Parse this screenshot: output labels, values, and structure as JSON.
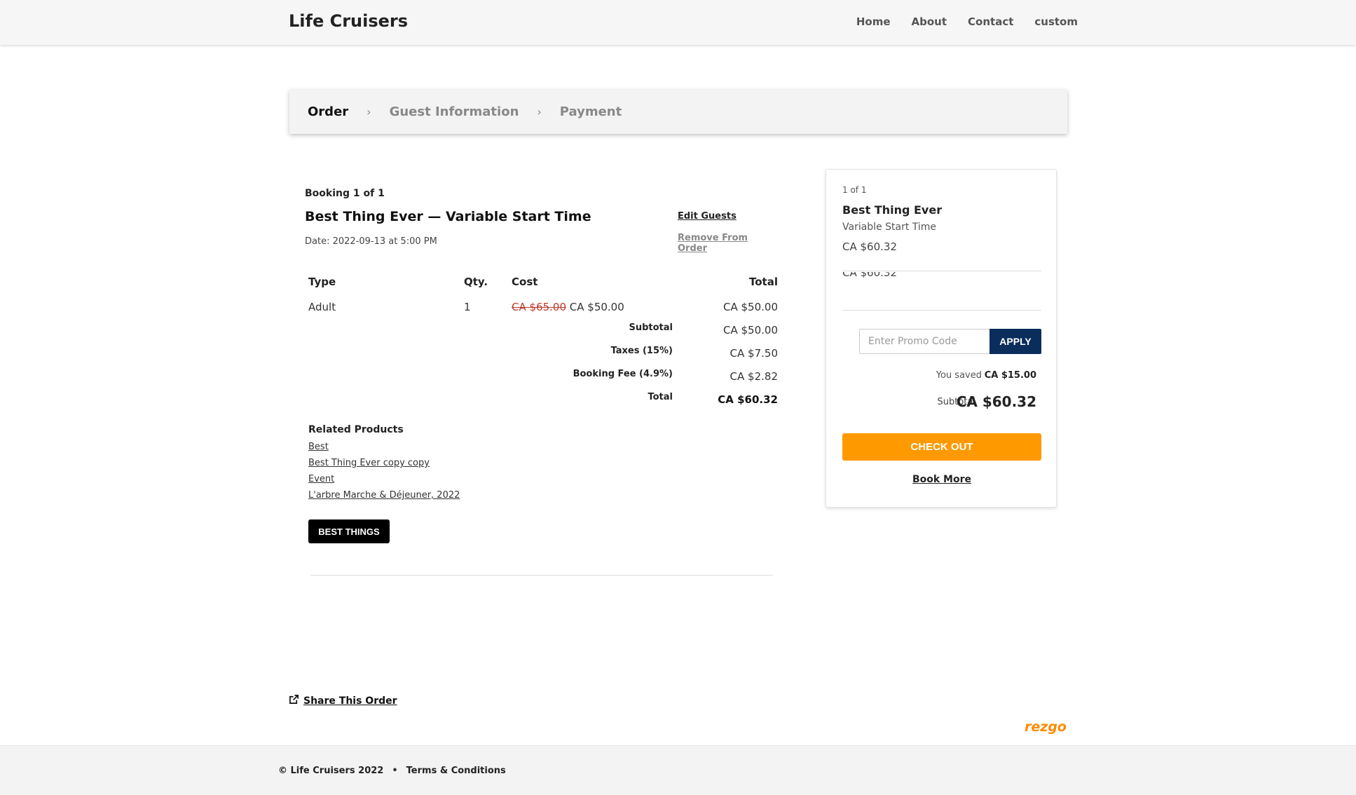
{
  "header": {
    "brand": "Life Cruisers",
    "nav": [
      "Home",
      "About",
      "Contact",
      "custom"
    ]
  },
  "steps": [
    "Order",
    "Guest Information",
    "Payment"
  ],
  "booking": {
    "count": "Booking 1 of 1",
    "title": "Best Thing Ever — Variable Start Time",
    "date": "Date: 2022-09-13 at 5:00 PM",
    "edit_guests": "Edit Guests",
    "remove": "Remove From Order",
    "table": {
      "headers": [
        "Type",
        "Qty.",
        "Cost",
        "Total"
      ],
      "row": {
        "type": "Adult",
        "qty": "1",
        "old_cost": "CA $65.00",
        "cost": "CA $50.00",
        "total": "CA $50.00"
      },
      "subtotal_label": "Subtotal",
      "subtotal": "CA $50.00",
      "taxes_label": "Taxes (15%)",
      "taxes": "CA $7.50",
      "fee_label": "Booking Fee (4.9%)",
      "fee": "CA $2.82",
      "total_label": "Total",
      "total": "CA $60.32"
    },
    "related": {
      "title": "Related Products",
      "items": [
        "Best",
        "Best Thing Ever copy copy",
        "Event",
        "L'arbre Marche & Déjeuner, 2022"
      ]
    },
    "tag_button": "BEST THINGS"
  },
  "cart": {
    "count": "1 of 1",
    "title": "Best Thing Ever",
    "subtitle": "Variable Start Time",
    "price": "CA $60.32",
    "clipped_price": "CA $60.32",
    "promo_placeholder": "Enter Promo Code",
    "apply": "APPLY",
    "saved_label": "You saved",
    "saved_value": "CA $15.00",
    "subtotal_label": "Subtotal",
    "subtotal_value": "CA $60.32",
    "checkout": "CHECK OUT",
    "book_more": "Book More"
  },
  "share": "Share This Order",
  "powered_by": "rezgo",
  "footer": {
    "copyright": "© Life Cruisers 2022",
    "separator": "•",
    "terms": "Terms & Conditions"
  },
  "colors": {
    "checkout": "#ff9900",
    "apply": "#0a2d5c",
    "strike": "#c0392b",
    "brand_logo": "#ff8a00"
  }
}
